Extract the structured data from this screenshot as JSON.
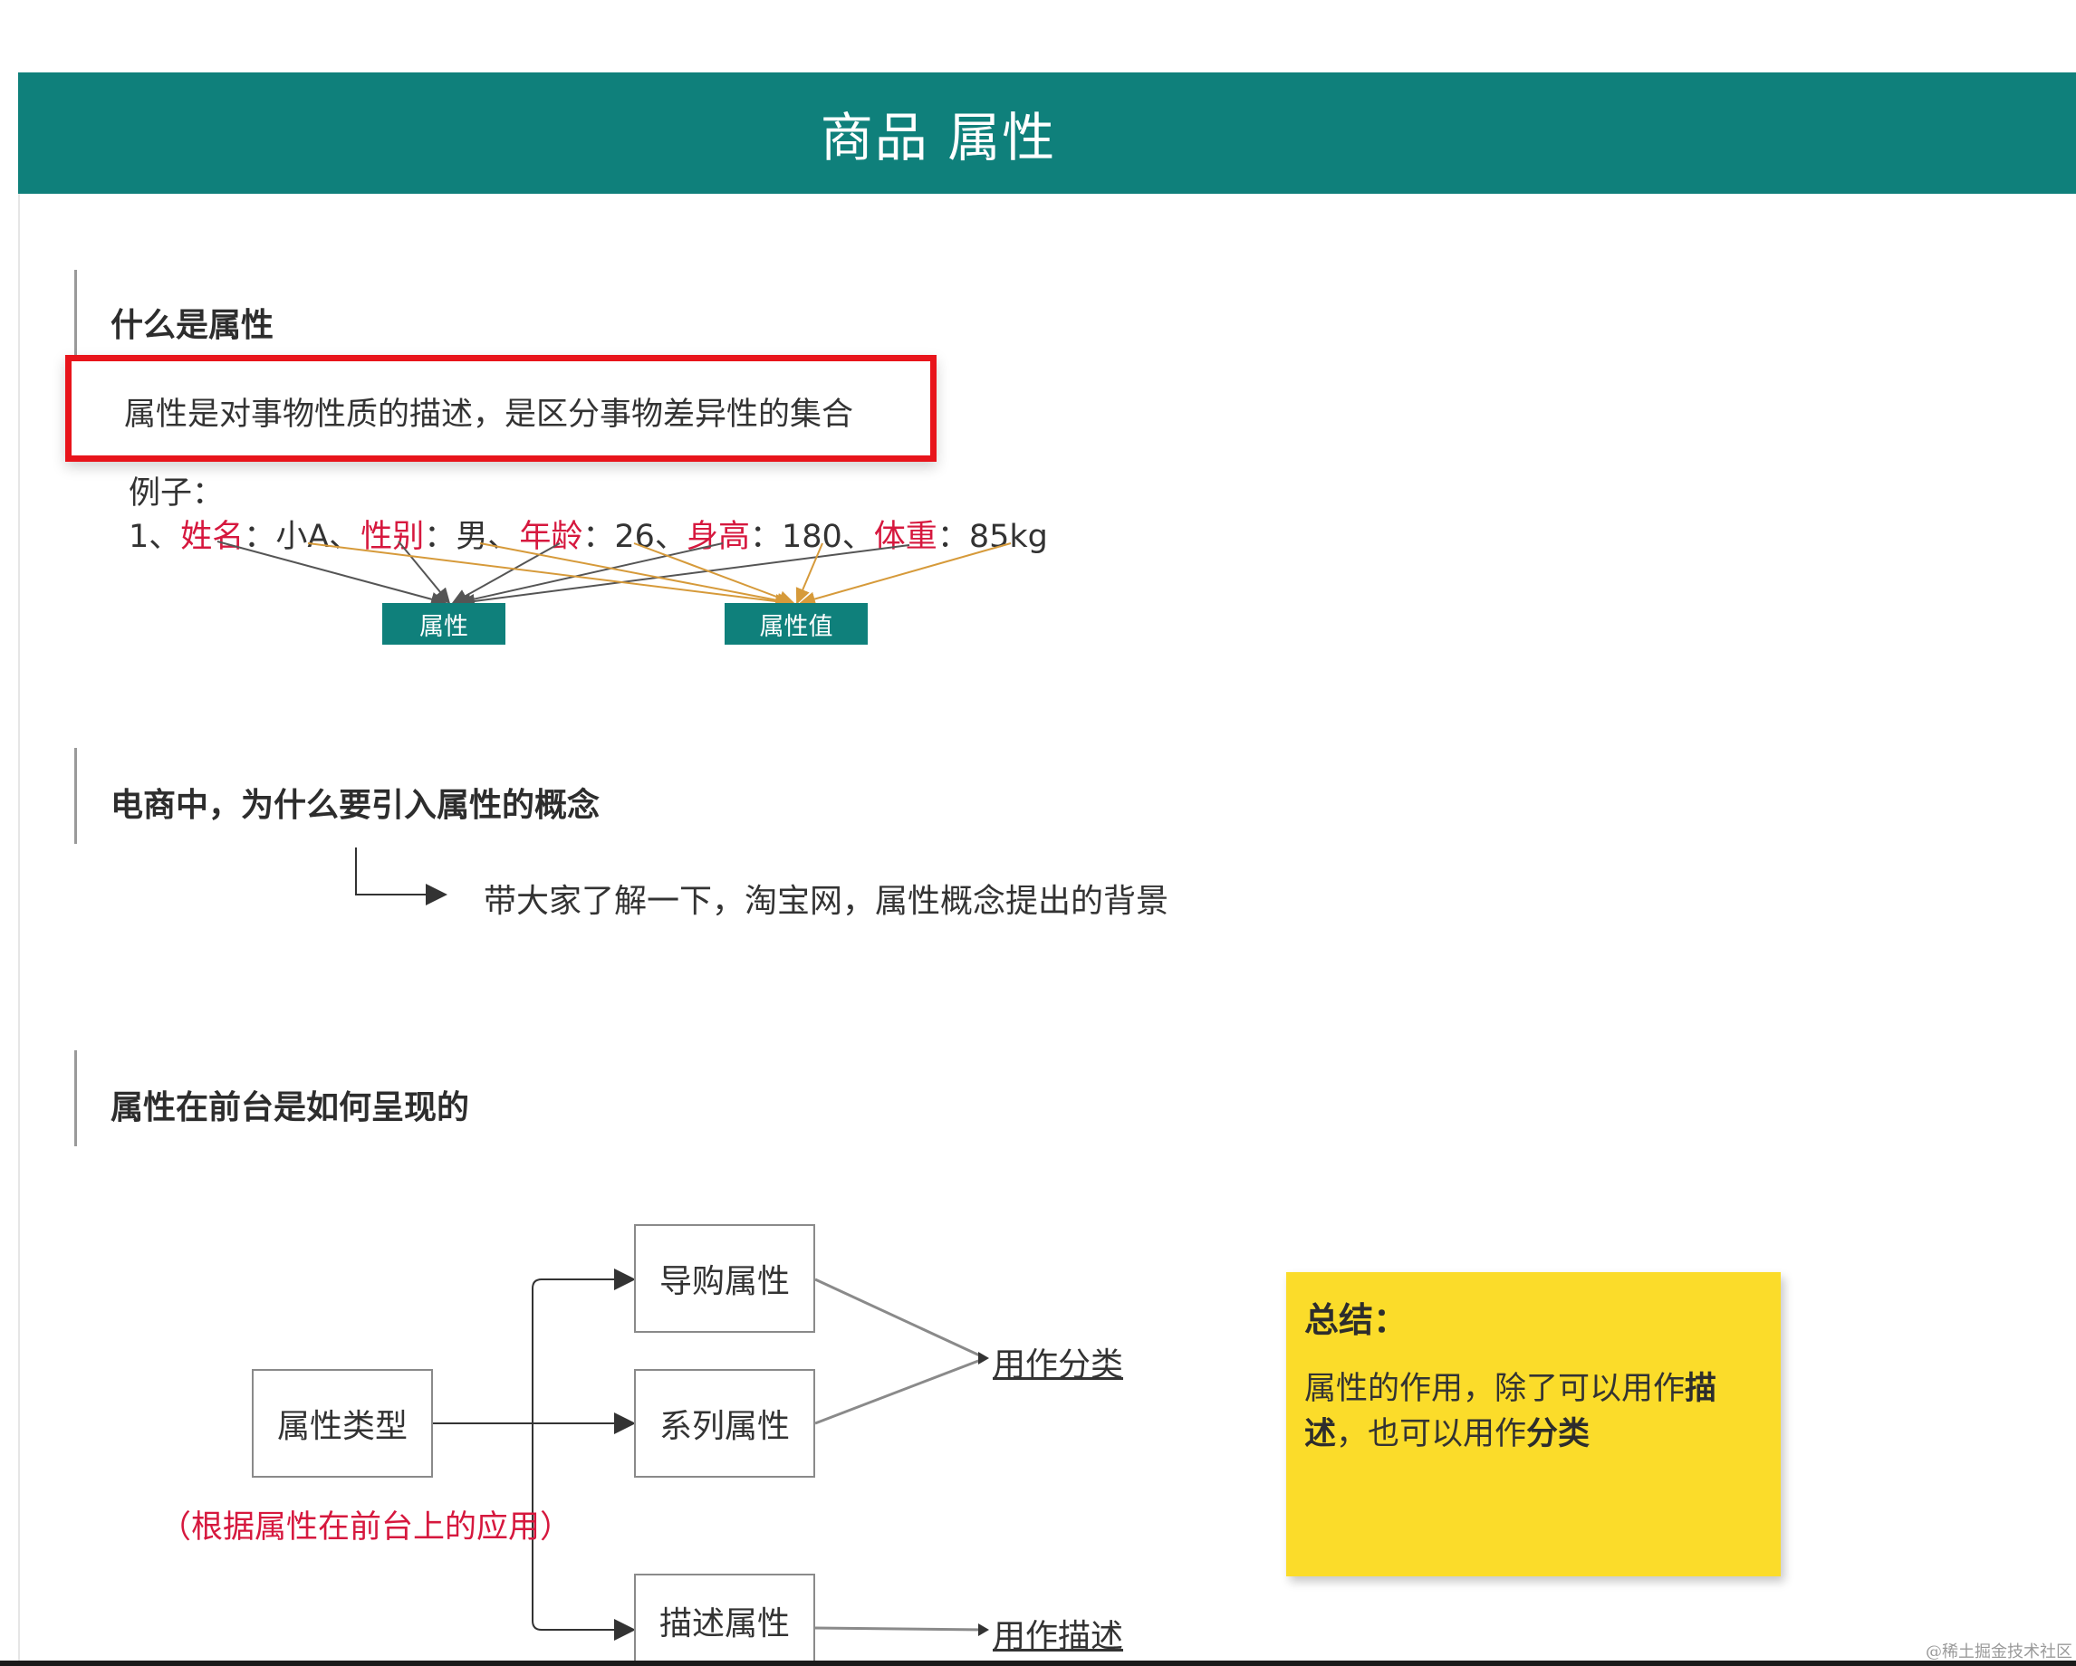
{
  "header": {
    "title": "商品 属性"
  },
  "section1": {
    "title": "什么是属性",
    "definition": "属性是对事物性质的描述，是区分事物差异性的集合",
    "example_label": "例子：",
    "example": {
      "prefix": "1、",
      "items": [
        {
          "key": "姓名",
          "sep": "：",
          "value": "小A",
          "tail": "、"
        },
        {
          "key": "性别",
          "sep": "：",
          "value": "男",
          "tail": "、"
        },
        {
          "key": "年龄",
          "sep": "：",
          "value": "26",
          "tail": "、"
        },
        {
          "key": "身高",
          "sep": "：",
          "value": "180",
          "tail": "、"
        },
        {
          "key": "体重",
          "sep": "：",
          "value": "85kg",
          "tail": ""
        }
      ]
    },
    "tags": {
      "attribute": "属性",
      "attribute_value": "属性值"
    }
  },
  "section2": {
    "title": "电商中，为什么要引入属性的概念",
    "background": "带大家了解一下，淘宝网，属性概念提出的背景"
  },
  "section3": {
    "title": "属性在前台是如何呈现的",
    "root": "属性类型",
    "note": "（根据属性在前台上的应用）",
    "branches": {
      "guide": "导购属性",
      "series": "系列属性",
      "describe": "描述属性"
    },
    "uses": {
      "classify": "用作分类",
      "describe": "用作描述"
    }
  },
  "summary": {
    "title": "总结：",
    "body_1": "属性的作用，除了可以用作",
    "bold_1": "描述",
    "body_2": "，也可以用作",
    "bold_2": "分类"
  },
  "watermark": "@稀土掘金技术社区",
  "colors": {
    "banner": "#0f807b",
    "highlight_border": "#e8141b",
    "key_text": "#d6183e",
    "summary_bg": "#fbdc2a",
    "line_gray": "#555555",
    "line_orange": "#d69a3a"
  }
}
